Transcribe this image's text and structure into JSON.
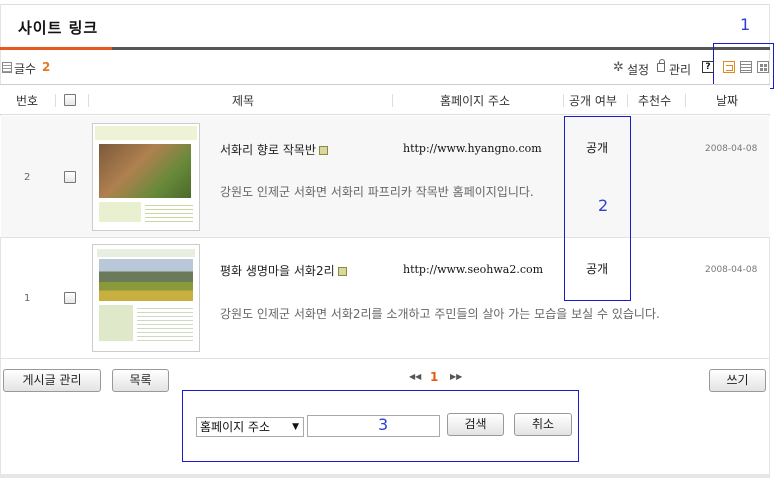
{
  "tab": {
    "title": "사이트 링크"
  },
  "annotations": [
    "1",
    "2",
    "3"
  ],
  "toolbar": {
    "count_label": "글수",
    "count_value": "2",
    "settings_label": "설정",
    "manage_label": "관리",
    "help_label": "?"
  },
  "table": {
    "headers": {
      "no": "번호",
      "title": "제목",
      "homepage": "홈페이지 주소",
      "visibility": "공개 여부",
      "recommend": "추천수",
      "date": "날짜"
    },
    "rows": [
      {
        "no": "2",
        "title": "서화리 향로 작목반",
        "url": "http://www.hyangno.com",
        "visibility": "공개",
        "date": "2008-04-08",
        "desc": "강원도 인제군 서화면 서화리 파프리카 작목반 홈페이지입니다."
      },
      {
        "no": "1",
        "title": "평화 생명마을 서화2리",
        "url": "http://www.seohwa2.com",
        "visibility": "공개",
        "date": "2008-04-08",
        "desc": "강원도 인제군 서화면 서화2리를 소개하고 주민들의 살아 가는 모습을 보실 수 있습니다."
      }
    ]
  },
  "buttons": {
    "manage_posts": "게시글 관리",
    "list": "목록",
    "write": "쓰기",
    "search": "검색",
    "cancel": "취소"
  },
  "pager": {
    "current": "1"
  },
  "search": {
    "field_selected": "홈페이지 주소"
  },
  "colors": {
    "accent": "#e8571c",
    "annotation": "#1a1ad0"
  }
}
